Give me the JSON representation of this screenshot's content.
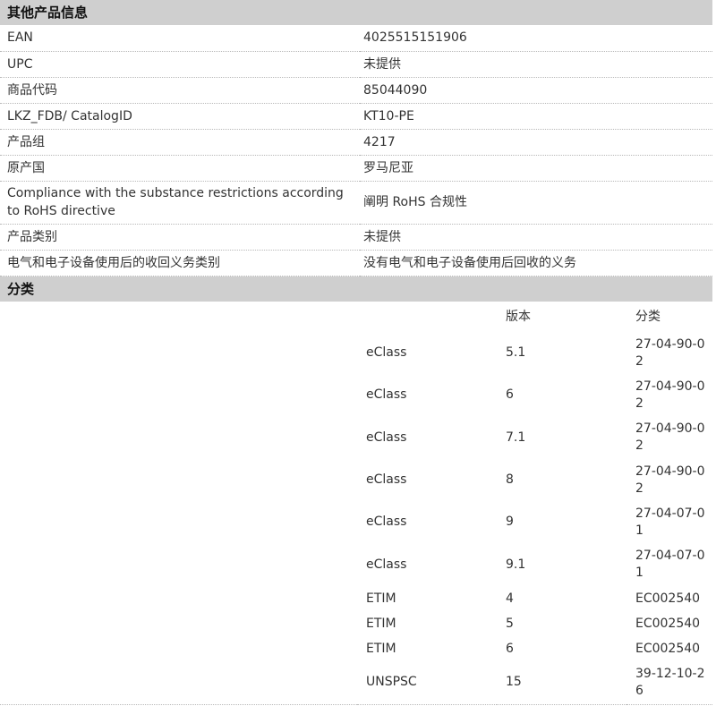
{
  "other_info": {
    "title": "其他产品信息",
    "rows": [
      {
        "key": "EAN",
        "value": "4025515151906"
      },
      {
        "key": "UPC",
        "value": "未提供"
      },
      {
        "key": "商品代码",
        "value": "85044090"
      },
      {
        "key": "LKZ_FDB/ CatalogID",
        "value": "KT10-PE"
      },
      {
        "key": "产品组",
        "value": "4217"
      },
      {
        "key": "原产国",
        "value": "罗马尼亚"
      },
      {
        "key": "Compliance with the substance restrictions according to RoHS directive",
        "value": "阐明 RoHS 合规性"
      },
      {
        "key": "产品类别",
        "value": "未提供"
      },
      {
        "key": "电气和电子设备使用后的收回义务类别",
        "value": "没有电气和电子设备使用后回收的义务"
      }
    ]
  },
  "classification": {
    "title": "分类",
    "headers": {
      "version": "版本",
      "class": "分类"
    },
    "rows": [
      {
        "system": "eClass",
        "version": "5.1",
        "code": "27-04-90-02"
      },
      {
        "system": "eClass",
        "version": "6",
        "code": "27-04-90-02"
      },
      {
        "system": "eClass",
        "version": "7.1",
        "code": "27-04-90-02"
      },
      {
        "system": "eClass",
        "version": "8",
        "code": "27-04-90-02"
      },
      {
        "system": "eClass",
        "version": "9",
        "code": "27-04-07-01"
      },
      {
        "system": "eClass",
        "version": "9.1",
        "code": "27-04-07-01"
      },
      {
        "system": "ETIM",
        "version": "4",
        "code": "EC002540"
      },
      {
        "system": "ETIM",
        "version": "5",
        "code": "EC002540"
      },
      {
        "system": "ETIM",
        "version": "6",
        "code": "EC002540"
      },
      {
        "system": "UNSPSC",
        "version": "15",
        "code": "39-12-10-26"
      }
    ]
  }
}
